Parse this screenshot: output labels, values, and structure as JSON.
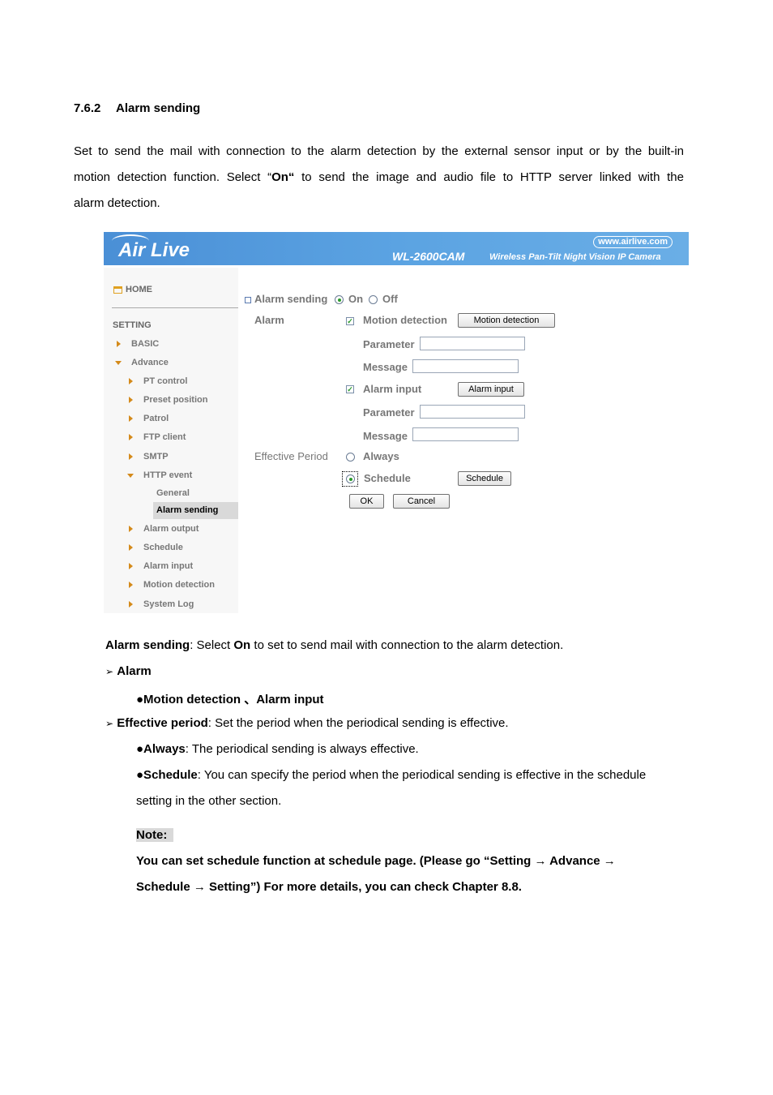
{
  "section": {
    "number": "7.6.2",
    "title": "Alarm sending"
  },
  "intro": {
    "lines": [
      "Set to send the mail with connection to the alarm detection by the external sensor input or by the built-in",
      [
        "motion detection function. Select “",
        "On“",
        " to send the image and audio file to HTTP server linked with the"
      ],
      "alarm detection."
    ]
  },
  "camera_ui": {
    "banner": {
      "logo": "Air Live",
      "site": "www.airlive.com",
      "model": "WL-2600CAM",
      "tagline": "Wireless Pan-Tilt Night Vision IP Camera"
    },
    "sidebar": {
      "home": "HOME",
      "setting": "SETTING",
      "items": [
        {
          "label": "BASIC",
          "level": 1,
          "icon": "arrow-right"
        },
        {
          "label": "Advance",
          "level": 1,
          "icon": "arrow-down"
        },
        {
          "label": "PT control",
          "level": 2,
          "icon": "arrow-right"
        },
        {
          "label": "Preset position",
          "level": 2,
          "icon": "arrow-right"
        },
        {
          "label": "Patrol",
          "level": 2,
          "icon": "arrow-right"
        },
        {
          "label": "FTP client",
          "level": 2,
          "icon": "arrow-right"
        },
        {
          "label": "SMTP",
          "level": 2,
          "icon": "arrow-right"
        },
        {
          "label": "HTTP event",
          "level": 2,
          "icon": "arrow-down"
        },
        {
          "label": "General",
          "level": 3
        },
        {
          "label": "Alarm sending",
          "level": 3,
          "selected": true
        },
        {
          "label": "Alarm output",
          "level": 2,
          "icon": "arrow-right"
        },
        {
          "label": "Schedule",
          "level": 2,
          "icon": "arrow-right"
        },
        {
          "label": "Alarm input",
          "level": 2,
          "icon": "arrow-right"
        },
        {
          "label": "Motion detection",
          "level": 2,
          "icon": "arrow-right"
        },
        {
          "label": "System Log",
          "level": 2,
          "icon": "arrow-right"
        }
      ]
    },
    "form": {
      "alarm_sending_label": "Alarm sending",
      "on_label": "On",
      "off_label": "Off",
      "alarm_sending_value": "On",
      "alarm_label": "Alarm",
      "motion_detection": {
        "label": "Motion detection",
        "checked": true,
        "button": "Motion detection",
        "parameter_label": "Parameter",
        "parameter_value": "",
        "message_label": "Message",
        "message_value": ""
      },
      "alarm_input": {
        "label": "Alarm input",
        "checked": true,
        "button": "Alarm input",
        "parameter_label": "Parameter",
        "parameter_value": "",
        "message_label": "Message",
        "message_value": ""
      },
      "effective_period_label": "Effective Period",
      "always_label": "Always",
      "schedule_label": "Schedule",
      "schedule_button": "Schedule",
      "effective_period_value": "Schedule",
      "ok": "OK",
      "cancel": "Cancel"
    }
  },
  "description": {
    "alarm_sending": {
      "term": "Alarm sending",
      "text1": ": Select ",
      "on": "On",
      "text2": " to set to send mail with connection to the alarm detection."
    },
    "alarm": {
      "bullet": "➢",
      "term": "Alarm"
    },
    "alarm_sub": "●Motion detection 、Alarm input",
    "effective": {
      "bullet": "➢",
      "term": "Effective period",
      "text": ": Set the period when the periodical sending is effective."
    },
    "always": {
      "term": "●Always",
      "text": ": The periodical sending is always effective."
    },
    "schedule": {
      "term": "●Schedule",
      "text": ": You can specify the period when the periodical sending is effective in the schedule",
      "line2": "setting in the other section."
    },
    "note_label": "Note:",
    "note_line1": "You can set schedule function at schedule page. (Please go “Setting → Advance →",
    "note_line2": "Schedule → Setting”) For more details, you can check Chapter 8.8."
  }
}
